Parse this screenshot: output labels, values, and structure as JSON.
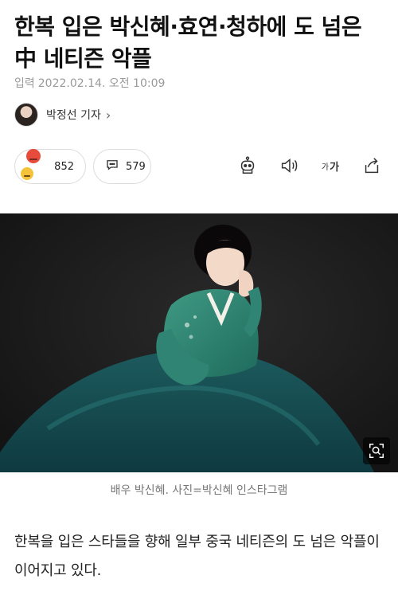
{
  "article": {
    "headline": "한복 입은 박신혜·효연·청하에 도 넘은 中 네티즌 악플",
    "meta_label": "입력",
    "date": "2022.02.14. 오전 10:09",
    "author": "박정선 기자",
    "author_chevron": "›"
  },
  "actions": {
    "reaction_count": "852",
    "comment_count": "579",
    "font_label_small": "가",
    "font_label_large": "가"
  },
  "icons": {
    "reactions": [
      "angry-emoji-icon",
      "smile-emoji-icon"
    ],
    "comment": "speech-bubble-icon",
    "robot": "robot-icon",
    "speaker": "speaker-icon",
    "share": "share-icon",
    "zoom": "zoom-icon"
  },
  "photo": {
    "caption": "배우 박신혜. 사진=박신혜 인스타그램"
  },
  "body": {
    "text": "한복을 입은 스타들을 향해 일부 중국 네티즌의 도 넘은 악플이 이어지고 있다."
  }
}
